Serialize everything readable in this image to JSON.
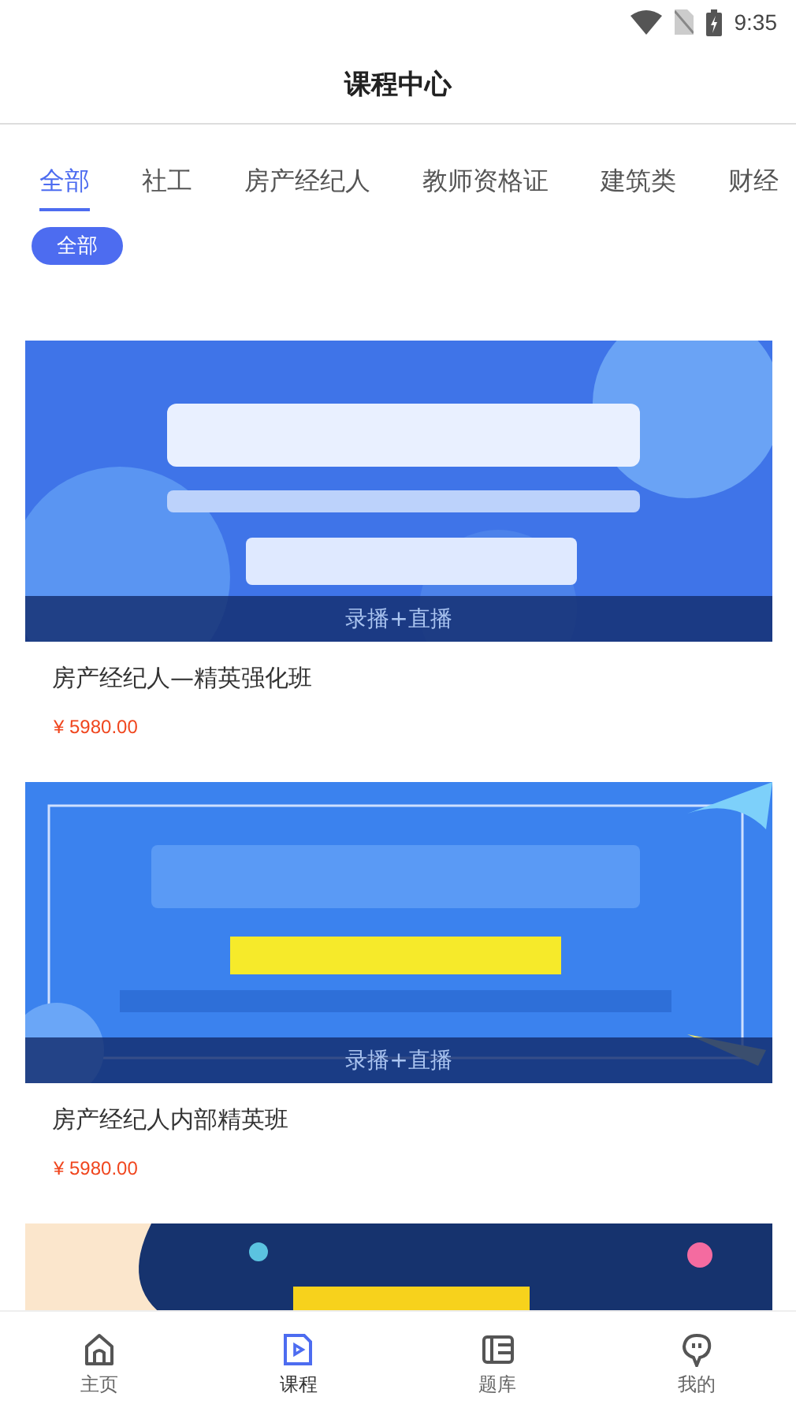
{
  "status_bar": {
    "time": "9:35"
  },
  "header": {
    "title": "课程中心"
  },
  "tabs": [
    {
      "label": "全部",
      "selected": true
    },
    {
      "label": "社工",
      "selected": false
    },
    {
      "label": "房产经纪人",
      "selected": false
    },
    {
      "label": "教师资格证",
      "selected": false
    },
    {
      "label": "建筑类",
      "selected": false
    },
    {
      "label": "财经",
      "selected": false
    }
  ],
  "filter_chips": [
    {
      "label": "全部",
      "selected": true
    }
  ],
  "courses": [
    {
      "mode": "录播+直播",
      "title": "房产经纪人—精英强化班",
      "price": "¥  5980.00"
    },
    {
      "mode": "录播+直播",
      "title": "房产经纪人内部精英班",
      "price": "¥  5980.00"
    }
  ],
  "bottom_nav": [
    {
      "label": "主页",
      "selected": false
    },
    {
      "label": "课程",
      "selected": true
    },
    {
      "label": "题库",
      "selected": false
    },
    {
      "label": "我的",
      "selected": false
    }
  ]
}
